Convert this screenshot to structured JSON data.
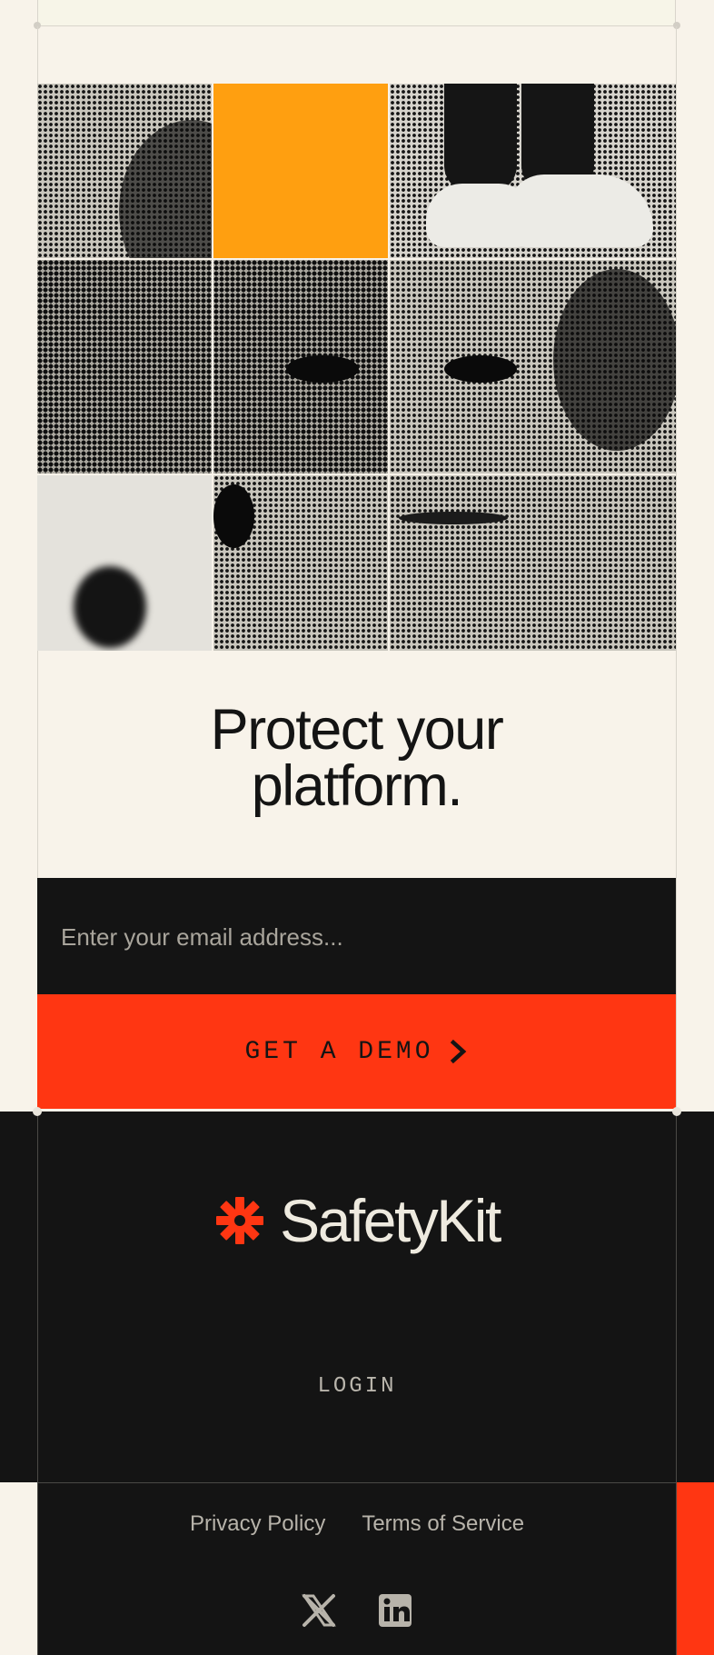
{
  "hero": {
    "headline_line1": "Protect your",
    "headline_line2": "platform."
  },
  "form": {
    "email_placeholder": "Enter your email address...",
    "demo_button_label": "GET A DEMO"
  },
  "footer": {
    "brand_name": "SafetyKit",
    "login_label": "LOGIN",
    "privacy_label": "Privacy Policy",
    "terms_label": "Terms of Service",
    "social_icons": [
      "x-icon",
      "linkedin-icon"
    ]
  },
  "colors": {
    "background": "#f8f3ea",
    "dark": "#141414",
    "accent_red": "#ff3612",
    "accent_orange": "#ff9f10"
  }
}
